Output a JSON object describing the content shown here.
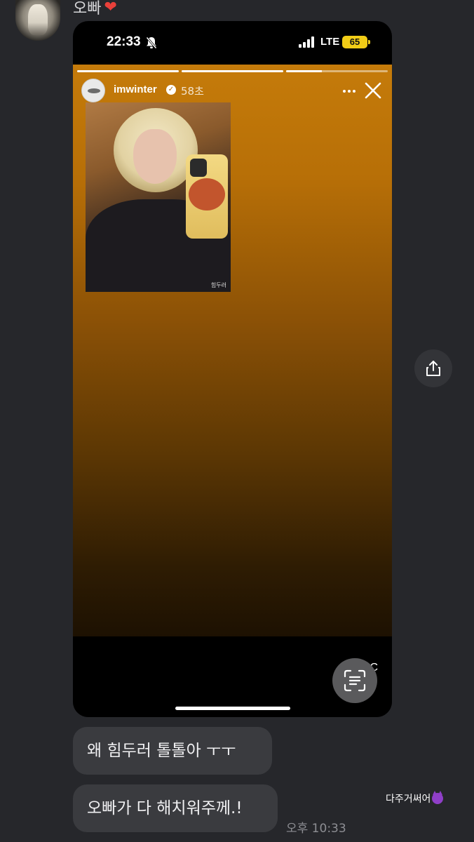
{
  "sender": {
    "caption": "오빠",
    "caption_emoji_icon": "red-heart-icon"
  },
  "shared_story": {
    "status_bar": {
      "time": "22:33",
      "silent_icon": "bell-slash-icon",
      "signal_icon": "cellular-signal-icon",
      "network": "LTE",
      "battery": "65"
    },
    "progress": [
      1.0,
      1.0,
      0.35
    ],
    "username": "imwinter",
    "verified_icon": "verified-badge-icon",
    "time_ago": "58초",
    "photo_caption": "힘두러",
    "send_label": "C"
  },
  "actions": {
    "share_icon": "share-icon",
    "scan_icon": "scan-text-icon"
  },
  "messages": [
    {
      "text": "왜 힘두러 톨톨아 ㅜㅜ"
    },
    {
      "text": "오빠가 다 해치워주께.!"
    }
  ],
  "message_time": "오후 10:33",
  "reaction": {
    "text": "다주거써어",
    "emoji_icon": "smiling-devil-icon"
  },
  "colors": {
    "background": "#26272b",
    "bubble": "#3a3b3f",
    "story_gradient_top": "#c57b0a",
    "story_gradient_bottom": "#1d1102",
    "battery": "#f2cd17"
  }
}
